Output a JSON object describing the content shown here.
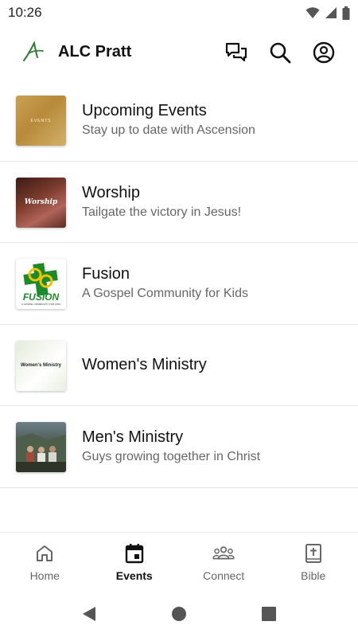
{
  "status_bar": {
    "time": "10:26",
    "icons": [
      "wifi-icon",
      "cellular-signal-icon",
      "battery-icon"
    ]
  },
  "header": {
    "app_title": "ALC Pratt",
    "logo_color": "#2e7d32",
    "actions": [
      "chat-icon",
      "search-icon",
      "account-icon"
    ]
  },
  "list": {
    "items": [
      {
        "title": "Upcoming Events",
        "subtitle": "Stay up to date with Ascension",
        "thumb_text": "EVENTS"
      },
      {
        "title": "Worship",
        "subtitle": "Tailgate the victory in Jesus!",
        "thumb_text": "Worship"
      },
      {
        "title": "Fusion",
        "subtitle": "A Gospel Community for Kids",
        "thumb_text": "FUSION",
        "thumb_subtext": "A GOSPEL COMMUNITY FOR KIDS"
      },
      {
        "title": "Women's Ministry",
        "subtitle": "",
        "thumb_text": "Women's Ministry"
      },
      {
        "title": "Men's Ministry",
        "subtitle": "Guys growing together in Christ",
        "thumb_text": ""
      }
    ]
  },
  "bottom_nav": {
    "active": "Events",
    "items": [
      {
        "label": "Home",
        "icon": "home-icon"
      },
      {
        "label": "Events",
        "icon": "calendar-icon"
      },
      {
        "label": "Connect",
        "icon": "group-icon"
      },
      {
        "label": "Bible",
        "icon": "bible-icon"
      }
    ]
  },
  "colors": {
    "divider": "#e6e6e6",
    "text_primary": "#111111",
    "text_secondary": "#666666",
    "fusion_green": "#1a8a2a",
    "fusion_yellow": "#f2c200"
  }
}
